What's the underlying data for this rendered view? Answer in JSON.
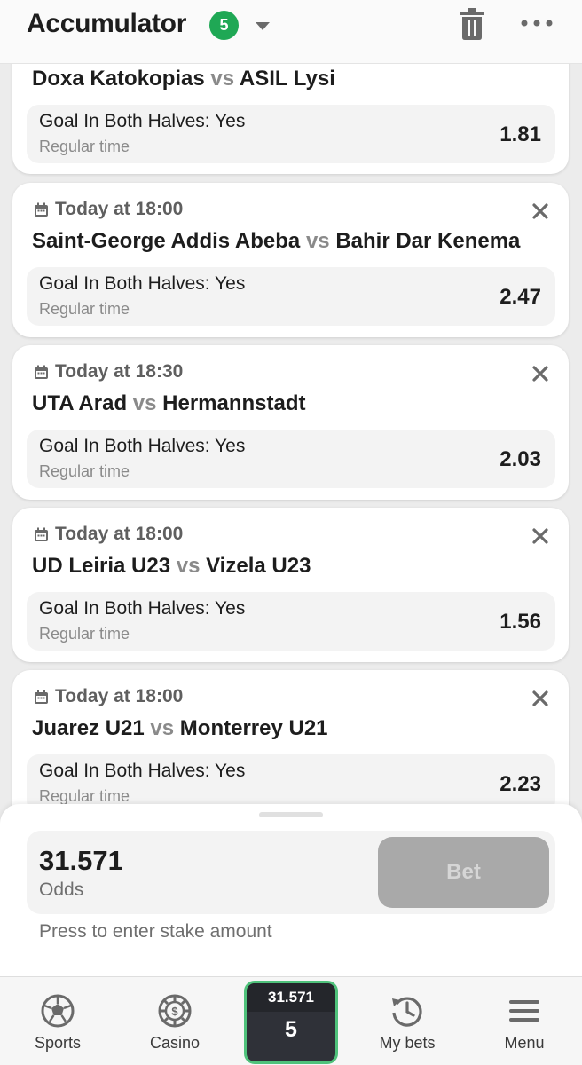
{
  "header": {
    "title": "Accumulator",
    "selection_count": "5"
  },
  "bets": [
    {
      "date": "",
      "home": "Doxa Katokopias",
      "vs": "vs",
      "away": "ASIL Lysi",
      "market": "Goal In Both Halves: Yes",
      "period": "Regular time",
      "odds": "1.81"
    },
    {
      "date": "Today at 18:00",
      "home": "Saint-George Addis Abeba",
      "vs": "vs",
      "away": "Bahir Dar Kenema",
      "market": "Goal In Both Halves: Yes",
      "period": "Regular time",
      "odds": "2.47"
    },
    {
      "date": "Today at 18:30",
      "home": "UTA Arad",
      "vs": "vs",
      "away": "Hermannstadt",
      "market": "Goal In Both Halves: Yes",
      "period": "Regular time",
      "odds": "2.03"
    },
    {
      "date": "Today at 18:00",
      "home": "UD Leiria U23",
      "vs": "vs",
      "away": "Vizela U23",
      "market": "Goal In Both Halves: Yes",
      "period": "Regular time",
      "odds": "1.56"
    },
    {
      "date": "Today at 18:00",
      "home": "Juarez U21",
      "vs": "vs",
      "away": "Monterrey U21",
      "market": "Goal In Both Halves: Yes",
      "period": "Regular time",
      "odds": "2.23"
    }
  ],
  "stake": {
    "total_odds": "31.571",
    "odds_label": "Odds",
    "bet_label": "Bet",
    "hint": "Press to enter stake amount"
  },
  "nav": {
    "sports": "Sports",
    "casino": "Casino",
    "slip_odds": "31.571",
    "slip_count": "5",
    "my_bets": "My bets",
    "menu": "Menu"
  },
  "colors": {
    "accent_green": "#1fa855",
    "slip_border": "#4fc27b",
    "disabled_button": "#a9a9a9"
  },
  "icons": {
    "header": [
      "chevron-down-icon",
      "trash-icon",
      "more-icon"
    ],
    "card": [
      "calendar-icon",
      "close-icon"
    ],
    "nav": [
      "soccer-ball-icon",
      "casino-chip-icon",
      "history-icon",
      "hamburger-menu-icon"
    ]
  }
}
